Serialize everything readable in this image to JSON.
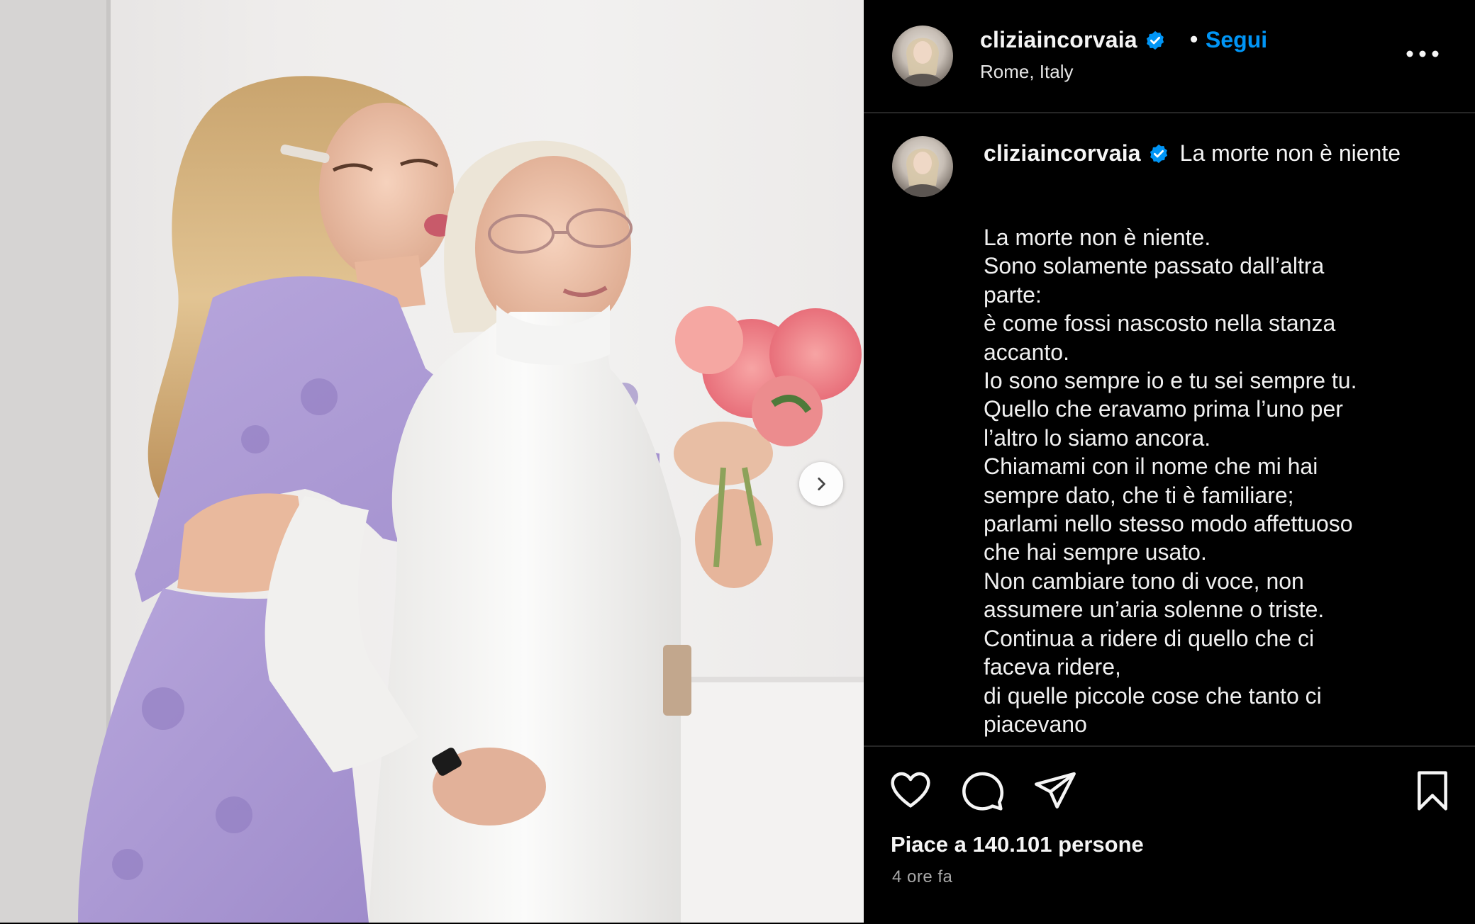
{
  "account": {
    "username": "cliziaincorvaia",
    "location": "Rome, Italy",
    "follow_label": "Segui",
    "separator": "•"
  },
  "caption": {
    "username": "cliziaincorvaia",
    "title": "La morte non è niente",
    "lines": [
      "La morte non è niente.",
      "Sono solamente passato dall’altra",
      "parte:",
      "è come fossi nascosto nella stanza",
      "accanto.",
      "Io sono sempre io e tu sei sempre tu.",
      "Quello che eravamo prima l’uno per",
      "l’altro lo siamo ancora.",
      "Chiamami con il nome che mi hai",
      "sempre dato, che ti è familiare;",
      "parlami nello stesso modo affettuoso",
      "che hai sempre usato.",
      "Non cambiare tono di voce, non",
      "assumere un’aria solenne o triste.",
      "Continua a ridere di quello che ci",
      "faceva ridere,",
      "di quelle piccole cose che tanto ci",
      "piacevano"
    ]
  },
  "engagement": {
    "likes_text": "Piace a 140.101 persone",
    "time_text": "4 ore fa"
  },
  "colors": {
    "background": "#000000",
    "accent": "#0095f6",
    "divider": "#262626",
    "muted_text": "#a8a8a8"
  },
  "icons": {
    "verified": "verified-badge-icon",
    "more": "more-options-icon",
    "like": "heart-icon",
    "comment": "comment-icon",
    "share": "share-icon",
    "save": "bookmark-icon",
    "next": "chevron-right-icon"
  }
}
